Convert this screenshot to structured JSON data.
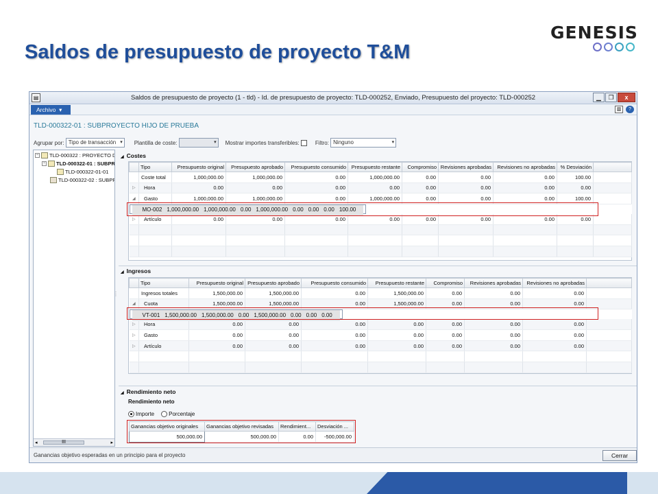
{
  "slide": {
    "title": "Saldos de presupuesto de proyecto T&M",
    "logo_text": "GENESIS"
  },
  "window": {
    "title": "Saldos de presupuesto de proyecto (1 - tld) - Id. de presupuesto de proyecto: TLD-000252, Enviado, Presupuesto del proyecto: TLD-000252",
    "menu_label": "Archivo",
    "project_title": "TLD-000322-01 : SUBPROYECTO HIJO DE PRUEBA",
    "close_label": "Cerrar",
    "status_text": "Ganancias objetivo esperadas en un principio para el proyecto"
  },
  "filters": {
    "group_by_label": "Agrupar por:",
    "group_by_value": "Tipo de transacción",
    "cost_template_label": "Plantilla de coste:",
    "cost_template_value": "",
    "show_transferable_label": "Mostrar importes transferibles:",
    "filter_label": "Filtro:",
    "filter_value": "Ninguno"
  },
  "tree": {
    "nodes": [
      {
        "label": "TLD-000322 : PROYECTO D"
      },
      {
        "label": "TLD-000322-01 : SUBPR"
      },
      {
        "label": "TLD-000322-01-01"
      },
      {
        "label": "TLD-000322-02 : SUBPR"
      }
    ],
    "scroll_thumb": "III"
  },
  "costes": {
    "heading": "Costes",
    "columns": [
      "Tipo",
      "Presupuesto original",
      "Presupuesto aprobado",
      "Presupuesto consumido",
      "Presupuesto restante",
      "Compromiso",
      "Revisiones aprobadas",
      "Revisiones no aprobadas",
      "% Desviación"
    ],
    "rows": [
      {
        "exp": "",
        "tipo": "Coste total",
        "v": [
          "1,000,000.00",
          "1,000,000.00",
          "0.00",
          "1,000,000.00",
          "0.00",
          "0.00",
          "0.00",
          "100.00"
        ]
      },
      {
        "exp": "▷",
        "tipo": "Hora",
        "v": [
          "0.00",
          "0.00",
          "0.00",
          "0.00",
          "0.00",
          "0.00",
          "0.00",
          "0.00"
        ]
      },
      {
        "exp": "◢",
        "tipo": "Gasto",
        "v": [
          "1,000,000.00",
          "1,000,000.00",
          "0.00",
          "1,000,000.00",
          "0.00",
          "0.00",
          "0.00",
          "100.00"
        ]
      },
      {
        "exp": "",
        "tipo": "MO-002",
        "v": [
          "1,000,000.00",
          "1,000,000.00",
          "0.00",
          "1,000,000.00",
          "0.00",
          "0.00",
          "0.00",
          "100.00"
        ]
      },
      {
        "exp": "▷",
        "tipo": "Artículo",
        "v": [
          "0.00",
          "0.00",
          "0.00",
          "0.00",
          "0.00",
          "0.00",
          "0.00",
          "0.00"
        ]
      }
    ]
  },
  "ingresos": {
    "heading": "Ingresos",
    "columns": [
      "Tipo",
      "Presupuesto original",
      "Presupuesto aprobado",
      "Presupuesto consumido",
      "Presupuesto restante",
      "Compromiso",
      "Revisiones aprobadas",
      "Revisiones no aprobadas"
    ],
    "rows": [
      {
        "exp": "",
        "tipo": "Ingresos totales",
        "v": [
          "1,500,000.00",
          "1,500,000.00",
          "0.00",
          "1,500,000.00",
          "0.00",
          "0.00",
          "0.00"
        ]
      },
      {
        "exp": "◢",
        "tipo": "Cuota",
        "v": [
          "1,500,000.00",
          "1,500,000.00",
          "0.00",
          "1,500,000.00",
          "0.00",
          "0.00",
          "0.00"
        ]
      },
      {
        "exp": "",
        "tipo": "VT-001",
        "v": [
          "1,500,000.00",
          "1,500,000.00",
          "0.00",
          "1,500,000.00",
          "0.00",
          "0.00",
          "0.00"
        ]
      },
      {
        "exp": "▷",
        "tipo": "Hora",
        "v": [
          "0.00",
          "0.00",
          "0.00",
          "0.00",
          "0.00",
          "0.00",
          "0.00"
        ]
      },
      {
        "exp": "▷",
        "tipo": "Gasto",
        "v": [
          "0.00",
          "0.00",
          "0.00",
          "0.00",
          "0.00",
          "0.00",
          "0.00"
        ]
      },
      {
        "exp": "▷",
        "tipo": "Artículo",
        "v": [
          "0.00",
          "0.00",
          "0.00",
          "0.00",
          "0.00",
          "0.00",
          "0.00"
        ]
      }
    ]
  },
  "rendimiento": {
    "heading": "Rendimiento neto",
    "subheading": "Rendimiento neto",
    "radio_importe": "Importe",
    "radio_porcentaje": "Porcentaje",
    "columns": [
      "Ganancias objetivo originales",
      "Ganancias objetivo revisadas",
      "Rendimient...",
      "Desviación ..."
    ],
    "values": [
      "500,000.00",
      "500,000.00",
      "0.00",
      "-500,000.00"
    ]
  }
}
